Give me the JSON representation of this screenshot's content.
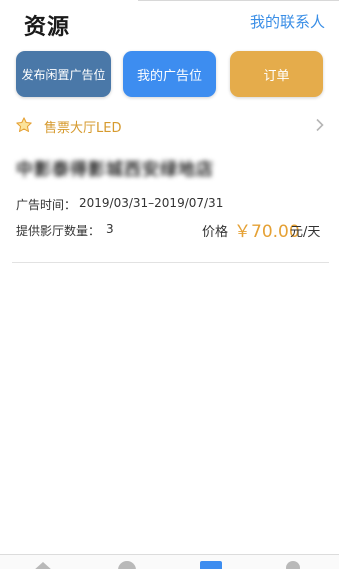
{
  "header": {
    "title": "资源",
    "contact_link": "我的联系人"
  },
  "actions": {
    "publish_label": "发布闲置广告位",
    "my_ads_label": "我的广告位",
    "orders_label": "订单"
  },
  "card": {
    "ad_type": "售票大厅LED",
    "cinema_name": "中影泰得影城西安绿地店",
    "period_label": "广告时间：",
    "period_value": "2019/03/31–2019/07/31",
    "screens_label": "提供影厅数量：",
    "screens_value": "3",
    "price_label": "价格",
    "price_value": "￥70.00",
    "price_unit": "元/天"
  },
  "tabbar": {
    "icons": [
      "home-icon",
      "discover-icon",
      "resource-icon",
      "mine-icon"
    ],
    "active": "resource-icon"
  },
  "colors": {
    "accent_blue": "#3d8df0",
    "publish_blue": "#4a78a8",
    "orders_orange": "#e5ac4b",
    "price_orange": "#e5a135",
    "link_blue": "#3a8ee6"
  }
}
